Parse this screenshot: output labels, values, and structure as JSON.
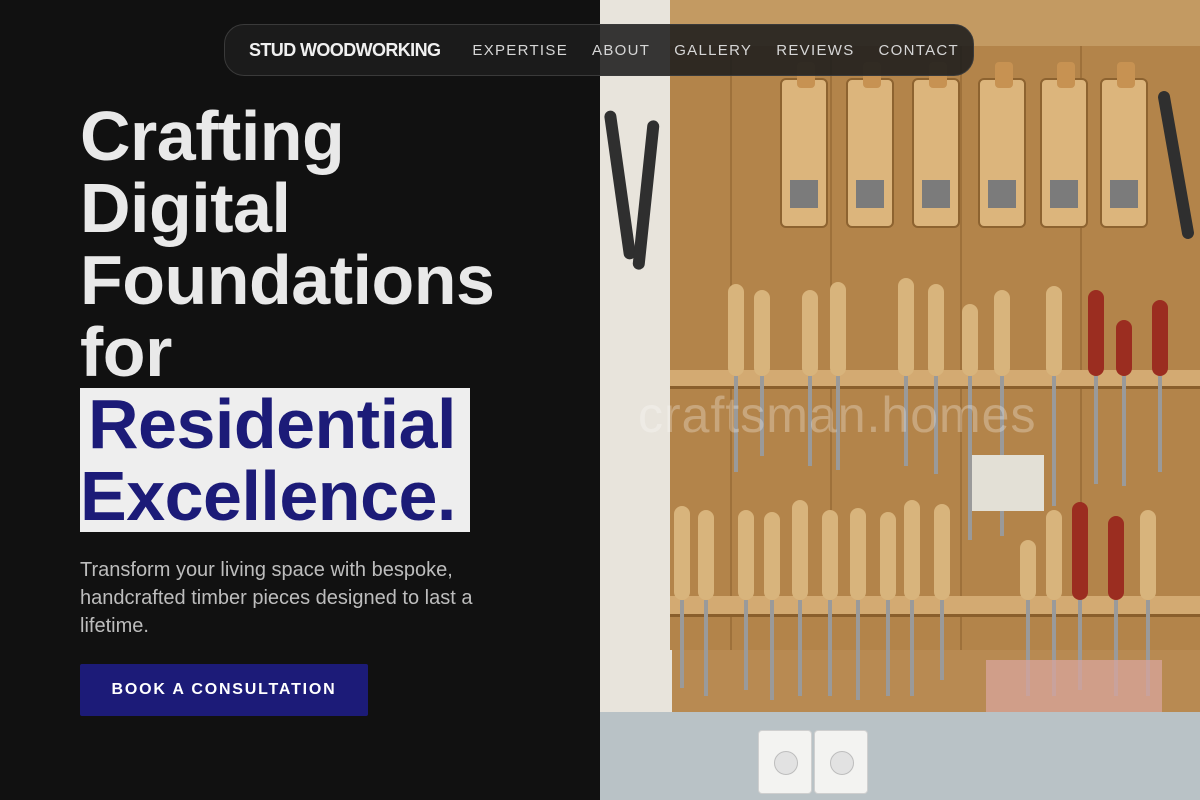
{
  "nav": {
    "brand": "STUD WOODWORKING",
    "links": [
      "EXPERTISE",
      "ABOUT",
      "GALLERY",
      "REVIEWS",
      "CONTACT"
    ]
  },
  "hero": {
    "headline_lines": [
      "Crafting",
      "Digital",
      "Foundations",
      "for"
    ],
    "highlight_lines": [
      "Residential",
      "Excellence."
    ],
    "subtitle": "Transform your living space with bespoke, handcrafted timber pieces designed to last a lifetime.",
    "cta_label": "BOOK A CONSULTATION"
  },
  "image": {
    "watermark": "craftsman.homes"
  },
  "colors": {
    "background": "#111111",
    "accent": "#1c1b78",
    "highlight_bg": "#eeeeee",
    "text": "#e9e9e9"
  }
}
